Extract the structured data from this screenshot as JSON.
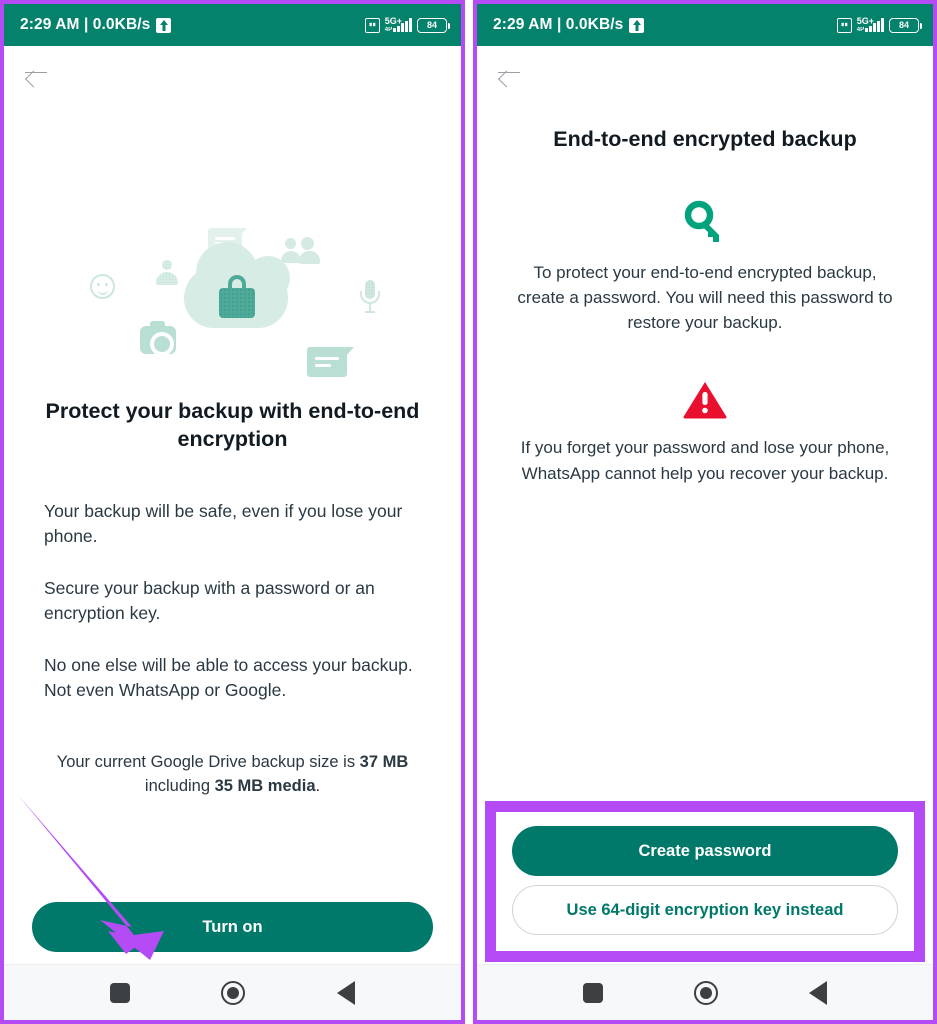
{
  "status_bar": {
    "time_and_speed": "2:29 AM | 0.0KB/s",
    "upload_icon": "upload-icon",
    "sim_icon": "sim-card-icon",
    "network_label": "5G+",
    "network_sub": "4P",
    "signal_icon": "signal-bars-icon",
    "battery_level": "84"
  },
  "colors": {
    "brand_teal": "#00786a",
    "status_bar_teal": "#04826c",
    "annotation_purple": "#b44bf5",
    "warning_red": "#e8102e",
    "illustration_mint": "#d6ece5",
    "text_dark": "#111b21",
    "text_body": "#2a3942"
  },
  "left_screen": {
    "back_icon": "back-arrow-icon",
    "illustration": {
      "name": "cloud-lock-illustration",
      "items": [
        "cloud-icon",
        "lock-icon",
        "smiley-icon",
        "person-icon",
        "group-icon",
        "camera-icon",
        "microphone-icon",
        "chat-bubble-small-icon",
        "chat-bubble-large-icon"
      ]
    },
    "title": "Protect your backup with end-to-end encryption",
    "paragraphs": [
      "Your backup will be safe, even if you lose your phone.",
      "Secure your backup with a password or an encryption key.",
      "No one else will be able to access your backup. Not even WhatsApp or Google."
    ],
    "backup_note": {
      "prefix": "Your current Google Drive backup size is ",
      "size": "37 MB",
      "middle": " including ",
      "media_size": "35 MB media",
      "suffix": "."
    },
    "primary_button": "Turn on"
  },
  "right_screen": {
    "back_icon": "back-arrow-icon",
    "title": "End-to-end encrypted backup",
    "key_icon": "key-icon",
    "body": "To protect your end-to-end encrypted backup, create a password. You will need this password to restore your backup.",
    "warning_icon": "warning-triangle-icon",
    "warning_text": "If you forget your password and lose your phone, WhatsApp cannot help you recover your backup.",
    "primary_button": "Create password",
    "secondary_button": "Use 64-digit encryption key instead"
  },
  "nav_bar": {
    "recents": "recents-square-icon",
    "home": "home-circle-icon",
    "back": "back-triangle-icon"
  },
  "annotations": {
    "arrow": "purple-arrow-pointing-to-turn-on-button",
    "highlight_box": "purple-highlight-box-around-buttons"
  }
}
